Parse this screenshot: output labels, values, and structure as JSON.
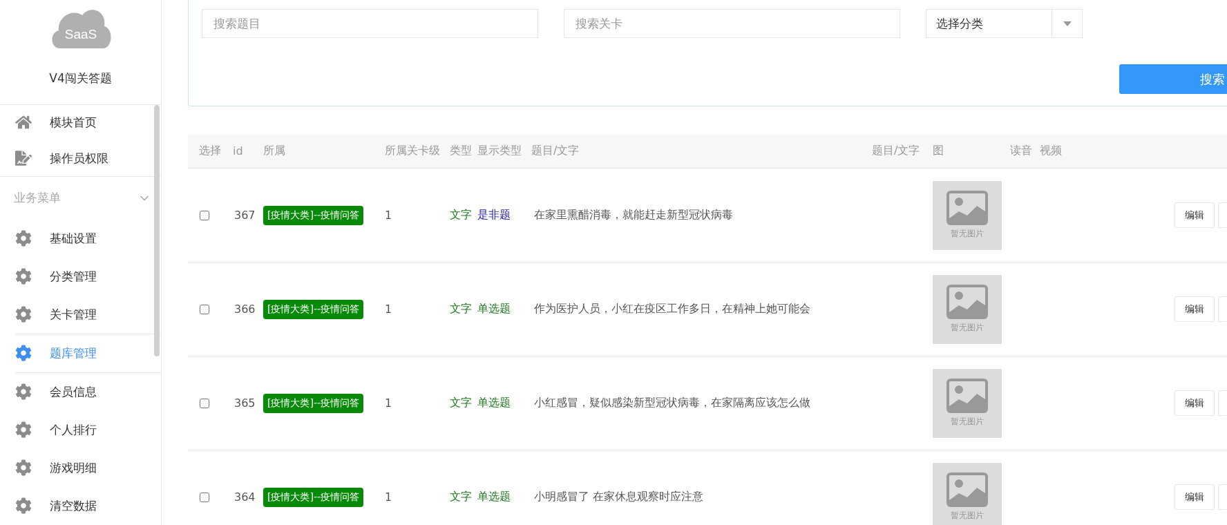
{
  "sidebar": {
    "logo_text": "SaaS",
    "title": "V4闯关答题",
    "top_items": [
      {
        "label": "模块首页",
        "kind": "home",
        "selected": false
      },
      {
        "label": "操作员权限",
        "kind": "doc",
        "selected": false
      }
    ],
    "group": {
      "label": "业务菜单",
      "expanded": true,
      "items": [
        {
          "label": "基础设置",
          "kind": "gear",
          "selected": false
        },
        {
          "label": "分类管理",
          "kind": "gear",
          "selected": false
        },
        {
          "label": "关卡管理",
          "kind": "gear",
          "selected": false
        },
        {
          "label": "题库管理",
          "kind": "gear",
          "selected": true
        },
        {
          "label": "会员信息",
          "kind": "gear",
          "selected": false
        },
        {
          "label": "个人排行",
          "kind": "gear",
          "selected": false
        },
        {
          "label": "游戏明细",
          "kind": "gear",
          "selected": false
        },
        {
          "label": "清空数据",
          "kind": "gear",
          "selected": false
        }
      ]
    }
  },
  "search": {
    "question_placeholder": "搜索题目",
    "level_placeholder": "搜索关卡",
    "category_value": "选择分类",
    "button": "搜索"
  },
  "table": {
    "columns": [
      "选择",
      "id",
      "所属",
      "所属关卡级",
      "类型",
      "显示类型",
      "题目/文字",
      "题目/文字",
      "图",
      "读音",
      "视频"
    ],
    "rows": [
      {
        "checked": false,
        "id": "367",
        "category": "[疫情大类]--疫情问答",
        "level": "1",
        "type": "文字",
        "display_type": {
          "text": "是非题",
          "color": "#1a1aa8"
        },
        "question": "在家里熏醋消毒，就能赶走新型冠状病毒",
        "image_placeholder": "暂无图片",
        "edit": "编辑"
      },
      {
        "checked": false,
        "id": "366",
        "category": "[疫情大类]--疫情问答",
        "level": "1",
        "type": "文字",
        "display_type": {
          "text": "单选题",
          "color": "#1e7a1e"
        },
        "question": "作为医护人员，小红在疫区工作多日，在精神上她可能会",
        "image_placeholder": "暂无图片",
        "edit": "编辑"
      },
      {
        "checked": false,
        "id": "365",
        "category": "[疫情大类]--疫情问答",
        "level": "1",
        "type": "文字",
        "display_type": {
          "text": "单选题",
          "color": "#1e7a1e"
        },
        "question": "小红感冒，疑似感染新型冠状病毒，在家隔离应该怎么做",
        "image_placeholder": "暂无图片",
        "edit": "编辑"
      },
      {
        "checked": false,
        "id": "364",
        "category": "[疫情大类]--疫情问答",
        "level": "1",
        "type": "文字",
        "display_type": {
          "text": "单选题",
          "color": "#1e7a1e"
        },
        "question": "小明感冒了 在家休息观察时应注意",
        "image_placeholder": "暂无图片",
        "edit": "编辑"
      }
    ]
  }
}
